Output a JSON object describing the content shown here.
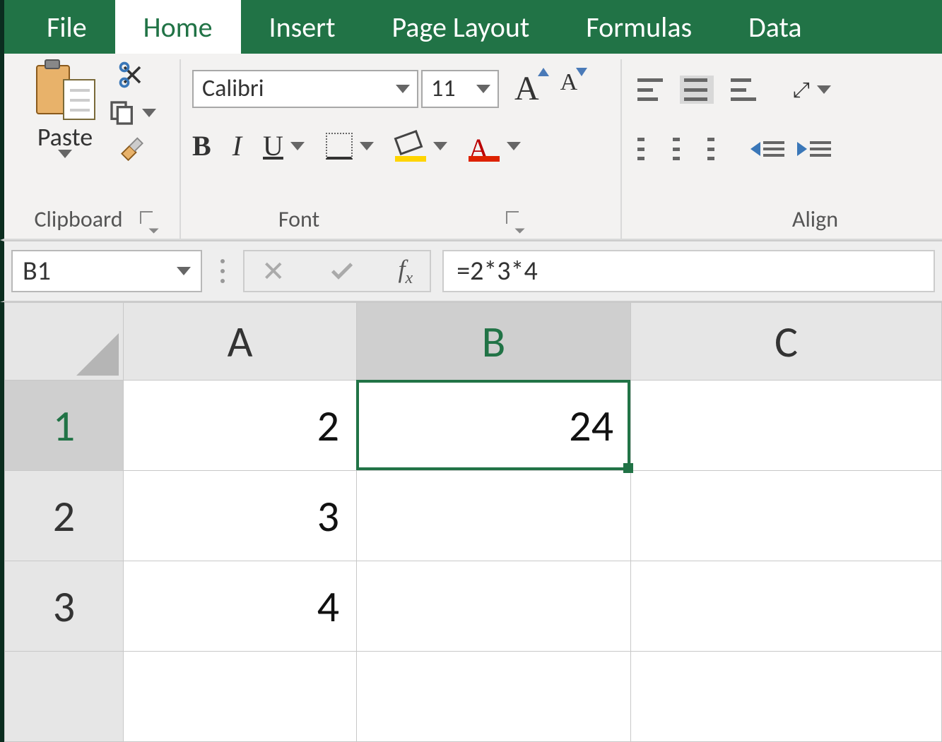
{
  "tabs": {
    "file": "File",
    "home": "Home",
    "insert": "Insert",
    "pagelayout": "Page Layout",
    "formulas": "Formulas",
    "data": "Data",
    "activeIndex": 1
  },
  "clipboard": {
    "groupLabel": "Clipboard",
    "pasteLabel": "Paste"
  },
  "font": {
    "groupLabel": "Font",
    "name": "Calibri",
    "size": "11",
    "accentYellow": "#ffd400",
    "accentRed": "#d20000"
  },
  "alignment": {
    "groupLabel": "Alignment",
    "groupLabelVisible": "Align"
  },
  "formulaBar": {
    "nameBox": "B1",
    "formula": "=2*3*4"
  },
  "sheet": {
    "columns": [
      "A",
      "B",
      "C"
    ],
    "rows": [
      "1",
      "2",
      "3"
    ],
    "cells": {
      "A1": "2",
      "A2": "3",
      "A3": "4",
      "B1": "24"
    },
    "selection": {
      "col": "B",
      "row": "1"
    }
  }
}
